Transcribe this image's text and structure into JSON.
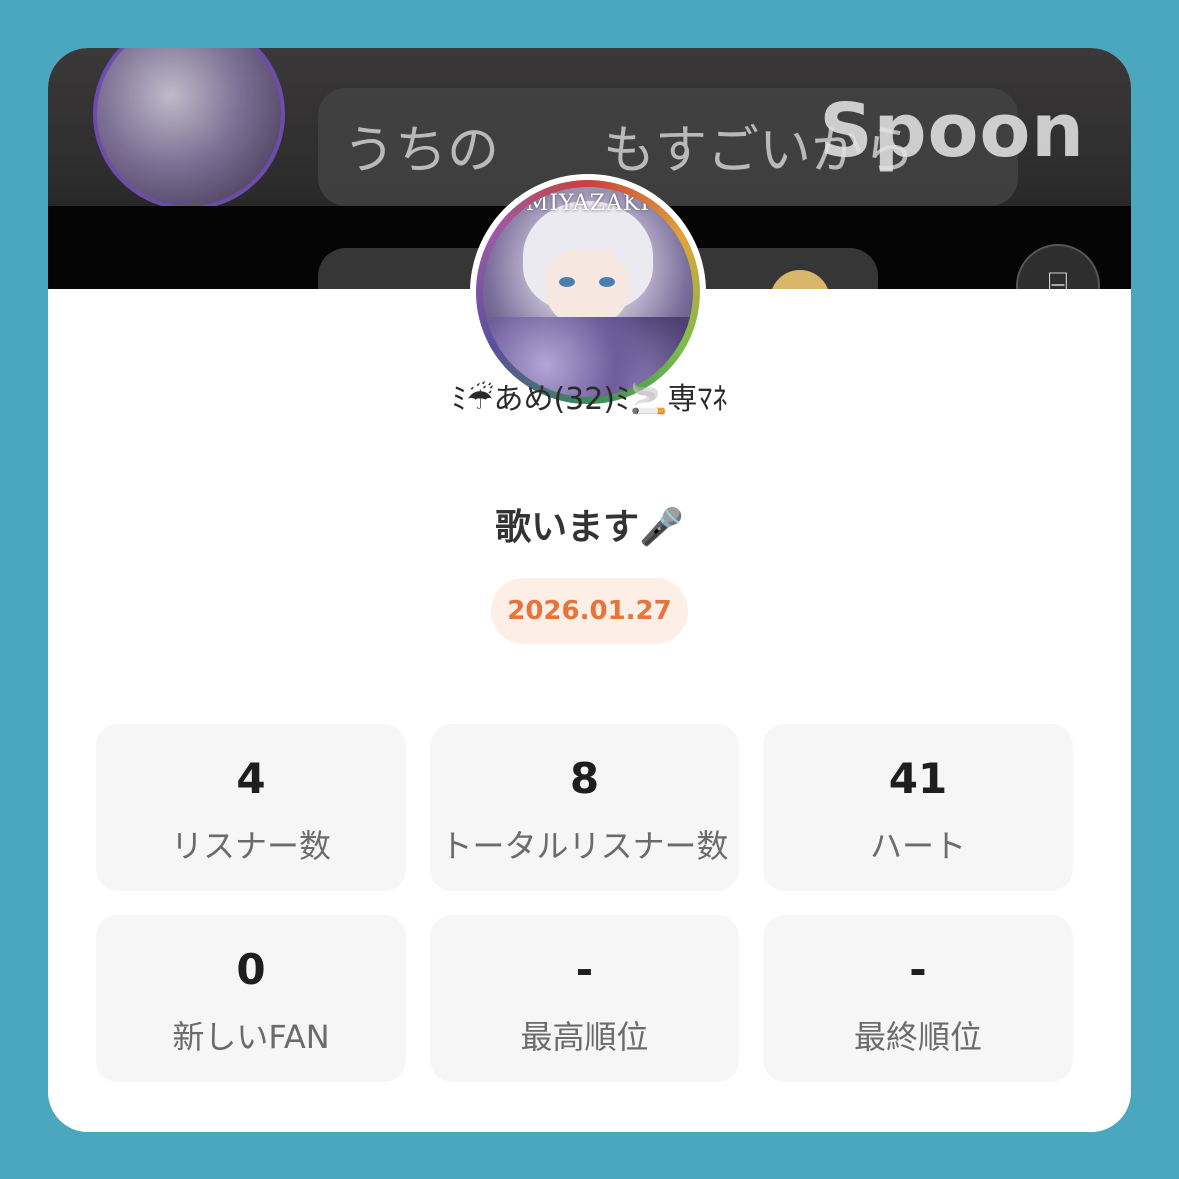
{
  "banner": {
    "brand": "Spoon",
    "bubble_text": "うちの　　もすごいから",
    "scan_icon": "scan-icon"
  },
  "profile": {
    "avatar_caption": "MIYAZAKI",
    "username": "ﾐ☔あめ(32)ﾐ🚬専ﾏﾈ"
  },
  "live": {
    "title": "歌います🎤",
    "date": "2026.01.27"
  },
  "stats": [
    {
      "value": "4",
      "label": "リスナー数"
    },
    {
      "value": "8",
      "label": "トータルリスナー数"
    },
    {
      "value": "41",
      "label": "ハート"
    },
    {
      "value": "0",
      "label": "新しいFAN"
    },
    {
      "value": "-",
      "label": "最高順位"
    },
    {
      "value": "-",
      "label": "最終順位"
    }
  ],
  "colors": {
    "background": "#4ba7bd",
    "card": "#ffffff",
    "date_badge_bg": "#fdeee6",
    "date_badge_text": "#e8743c",
    "stat_tile": "#f6f6f6"
  }
}
